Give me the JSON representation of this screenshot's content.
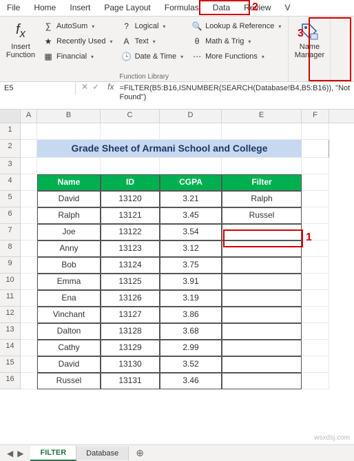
{
  "ribbon": {
    "tabs": [
      "File",
      "Home",
      "Insert",
      "Page Layout",
      "Formulas",
      "Data",
      "Review",
      "V"
    ],
    "insert_fn": "Insert\nFunction",
    "group_label": "Function Library",
    "name_mgr": "Name\nManager",
    "col1": [
      "AutoSum",
      "Recently Used",
      "Financial"
    ],
    "col2": [
      "Logical",
      "Text",
      "Date & Time"
    ],
    "col3": [
      "Lookup & Reference",
      "Math & Trig",
      "More Functions"
    ]
  },
  "namebox": "E5",
  "formula": "=FILTER(B5:B16,ISNUMBER(SEARCH(Database!B4,B5:B16)), \"Not Found\")",
  "columns": [
    "A",
    "B",
    "C",
    "D",
    "E",
    "F"
  ],
  "title": "Grade Sheet of Armani School and College",
  "headers": [
    "Name",
    "ID",
    "CGPA",
    "Filter"
  ],
  "rows": [
    {
      "n": "David",
      "id": "13120",
      "g": "3.21",
      "f": "Ralph"
    },
    {
      "n": "Ralph",
      "id": "13121",
      "g": "3.45",
      "f": "Russel"
    },
    {
      "n": "Joe",
      "id": "13122",
      "g": "3.54",
      "f": ""
    },
    {
      "n": "Anny",
      "id": "13123",
      "g": "3.12",
      "f": ""
    },
    {
      "n": "Bob",
      "id": "13124",
      "g": "3.75",
      "f": ""
    },
    {
      "n": "Emma",
      "id": "13125",
      "g": "3.91",
      "f": ""
    },
    {
      "n": "Ena",
      "id": "13126",
      "g": "3.19",
      "f": ""
    },
    {
      "n": "Vinchant",
      "id": "13127",
      "g": "3.86",
      "f": ""
    },
    {
      "n": "Dalton",
      "id": "13128",
      "g": "3.68",
      "f": ""
    },
    {
      "n": "Cathy",
      "id": "13129",
      "g": "2.99",
      "f": ""
    },
    {
      "n": "David",
      "id": "13130",
      "g": "3.52",
      "f": ""
    },
    {
      "n": "Russel",
      "id": "13131",
      "g": "3.46",
      "f": ""
    }
  ],
  "sheets": [
    "FILTER",
    "Database"
  ],
  "annotations": {
    "a1": "1",
    "a2": "2",
    "a3": "3"
  },
  "watermark": "wsxdsj.com"
}
